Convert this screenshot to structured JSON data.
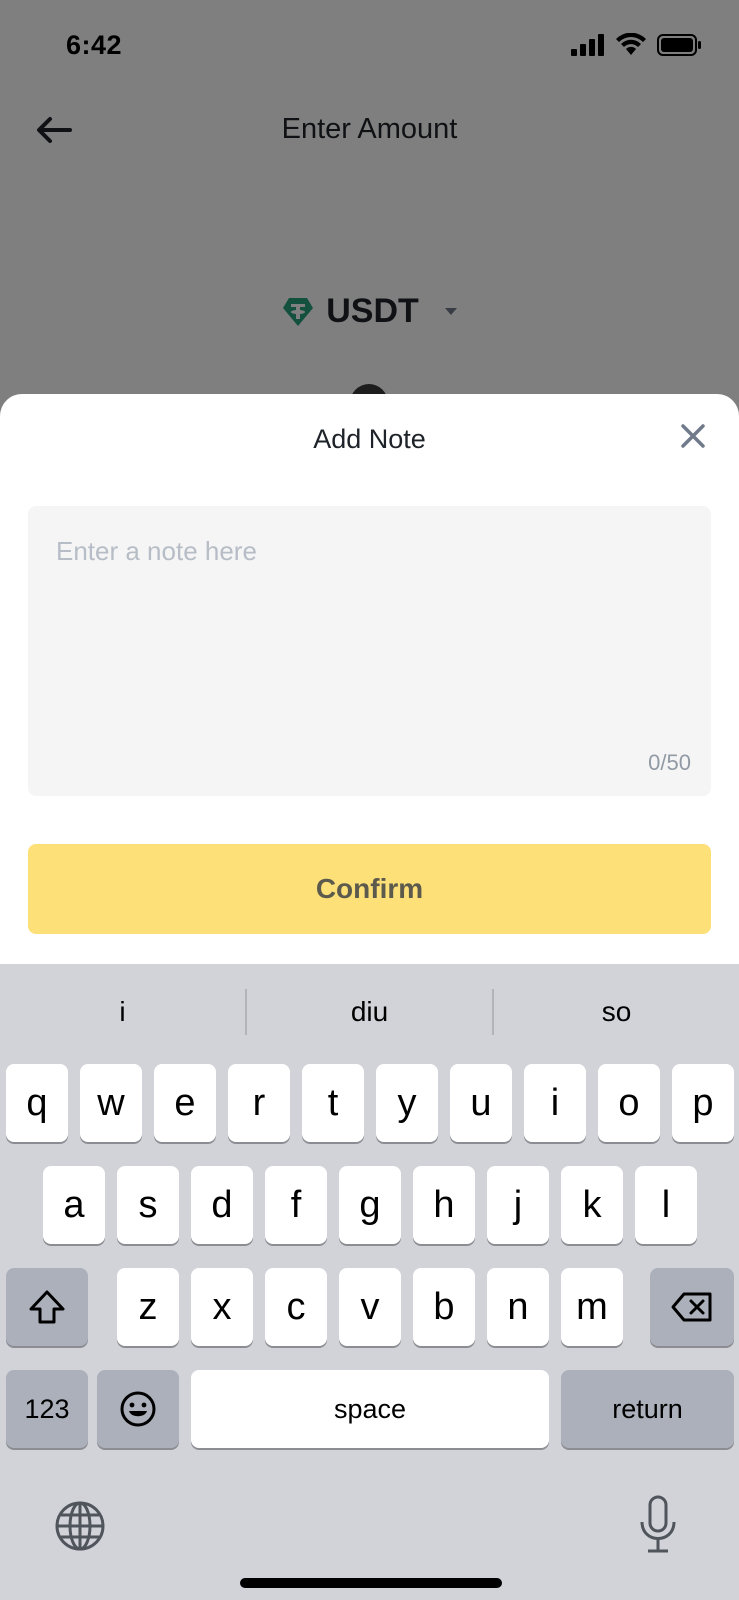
{
  "status": {
    "time": "6:42"
  },
  "nav": {
    "title": "Enter Amount"
  },
  "currency": {
    "symbol": "USDT",
    "icon_color": "#26a17b"
  },
  "sheet": {
    "title": "Add Note",
    "note_placeholder": "Enter a note here",
    "note_counter": "0/50",
    "confirm_label": "Confirm"
  },
  "keyboard": {
    "suggestions": [
      "i",
      "diu",
      "so"
    ],
    "row1": [
      "q",
      "w",
      "e",
      "r",
      "t",
      "y",
      "u",
      "i",
      "o",
      "p"
    ],
    "row2": [
      "a",
      "s",
      "d",
      "f",
      "g",
      "h",
      "j",
      "k",
      "l"
    ],
    "row3": [
      "z",
      "x",
      "c",
      "v",
      "b",
      "n",
      "m"
    ],
    "numbers_label": "123",
    "space_label": "space",
    "return_label": "return"
  },
  "colors": {
    "accent": "#fde077",
    "keyboard_bg": "#d1d3d9"
  }
}
